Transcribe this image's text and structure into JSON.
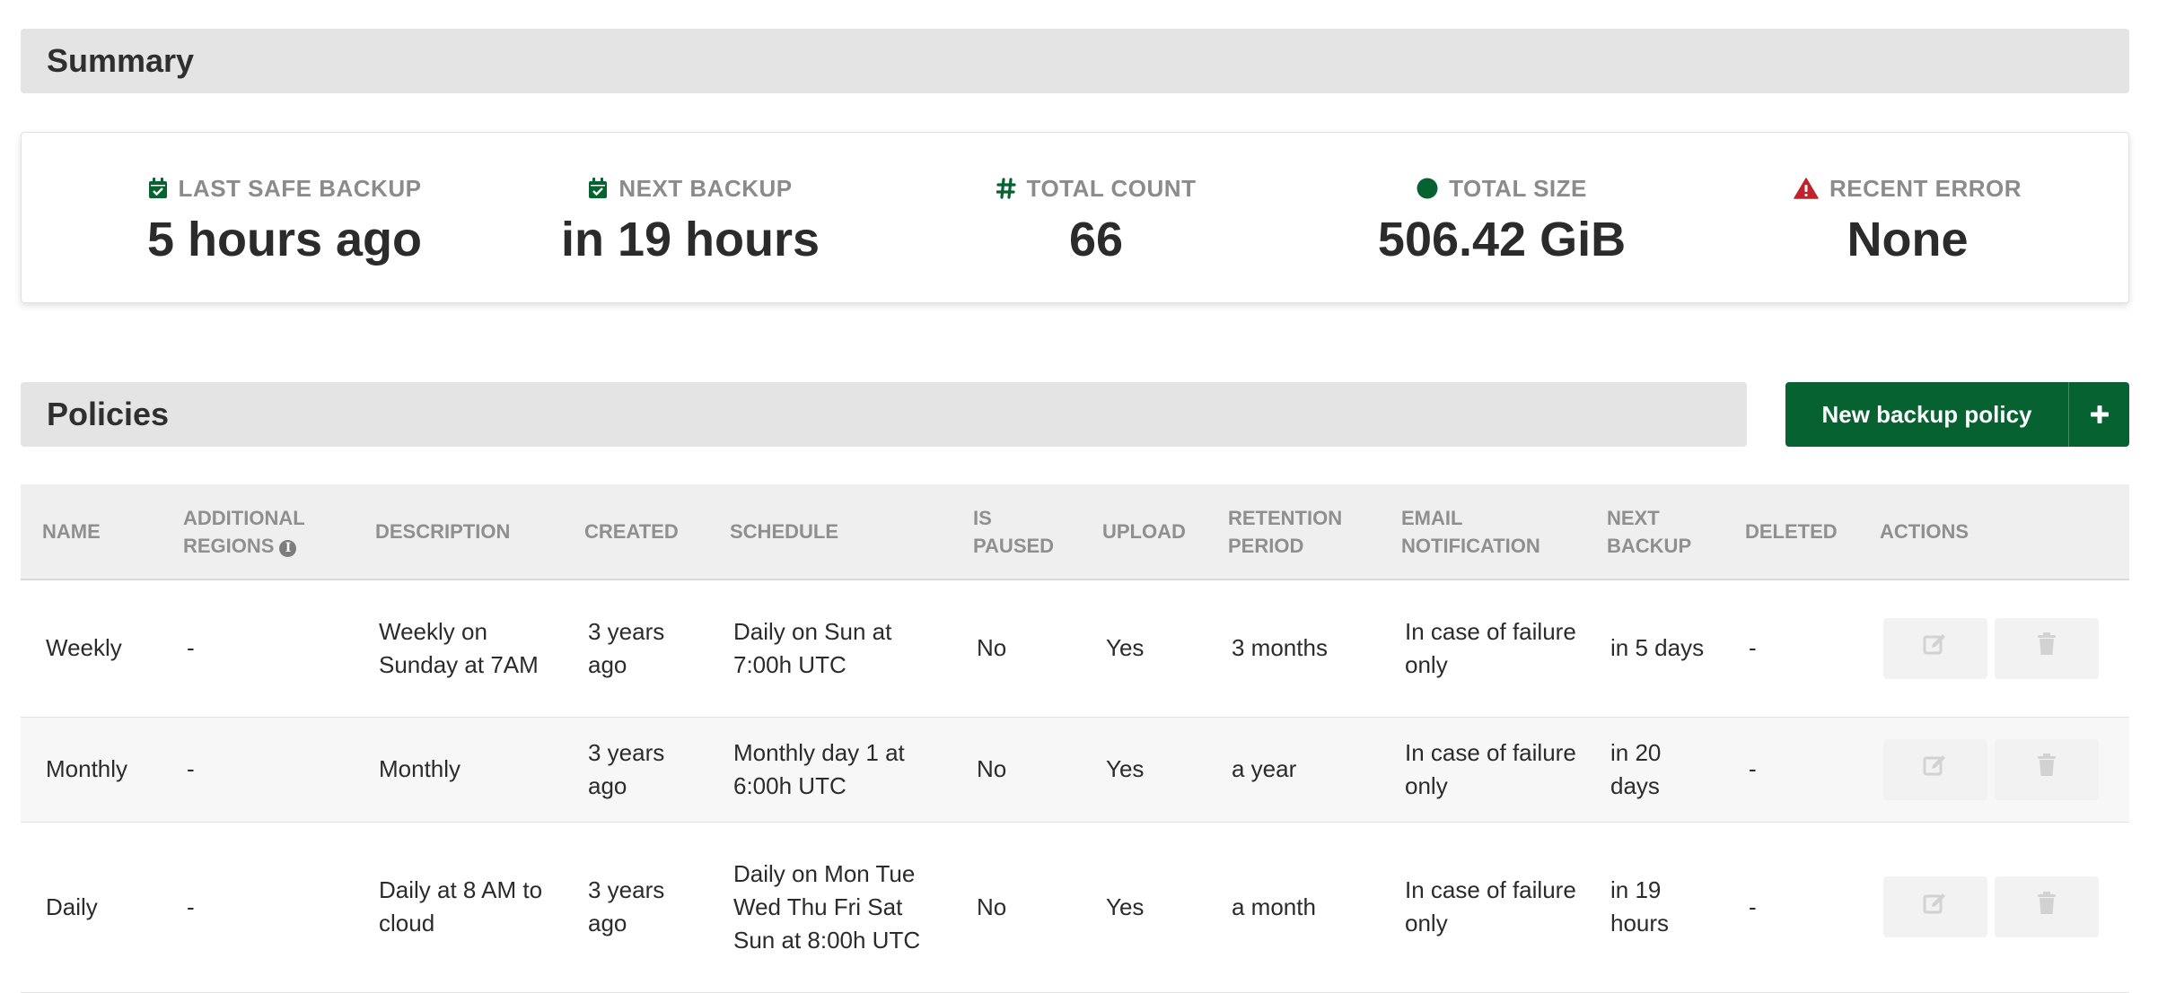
{
  "summary": {
    "title": "Summary",
    "stats": [
      {
        "label": "LAST SAFE BACKUP",
        "value": "5 hours ago",
        "icon": "calendar-check-icon"
      },
      {
        "label": "NEXT BACKUP",
        "value": "in 19 hours",
        "icon": "calendar-check-icon"
      },
      {
        "label": "TOTAL COUNT",
        "value": "66",
        "icon": "hash-icon"
      },
      {
        "label": "TOTAL SIZE",
        "value": "506.42 GiB",
        "icon": "circle-icon"
      },
      {
        "label": "RECENT ERROR",
        "value": "None",
        "icon": "warning-triangle-icon"
      }
    ]
  },
  "policies": {
    "title": "Policies",
    "new_button_label": "New backup policy",
    "columns": [
      "NAME",
      "ADDITIONAL REGIONS",
      "DESCRIPTION",
      "CREATED",
      "SCHEDULE",
      "IS PAUSED",
      "UPLOAD",
      "RETENTION PERIOD",
      "EMAIL NOTIFICATION",
      "NEXT BACKUP",
      "DELETED",
      "ACTIONS"
    ],
    "rows": [
      [
        "Weekly",
        "-",
        "Weekly on Sunday at 7AM",
        "3 years ago",
        "Daily on Sun at 7:00h UTC",
        "No",
        "Yes",
        "3 months",
        "In case of failure only",
        "in 5 days",
        "-"
      ],
      [
        "Monthly",
        "-",
        "Monthly",
        "3 years ago",
        "Monthly day 1 at 6:00h UTC",
        "No",
        "Yes",
        "a year",
        "In case of failure only",
        "in 20 days",
        "-"
      ],
      [
        "Daily",
        "-",
        "Daily at 8 AM to cloud",
        "3 years ago",
        "Daily on Mon Tue Wed Thu Fri Sat Sun at 8:00h UTC",
        "No",
        "Yes",
        "a month",
        "In case of failure only",
        "in 19 hours",
        "-"
      ]
    ]
  },
  "colors": {
    "accent_green": "#066331",
    "error_red": "#c0232c",
    "header_bg": "#e4e4e4",
    "disabled_button": "#f2f2f2"
  }
}
